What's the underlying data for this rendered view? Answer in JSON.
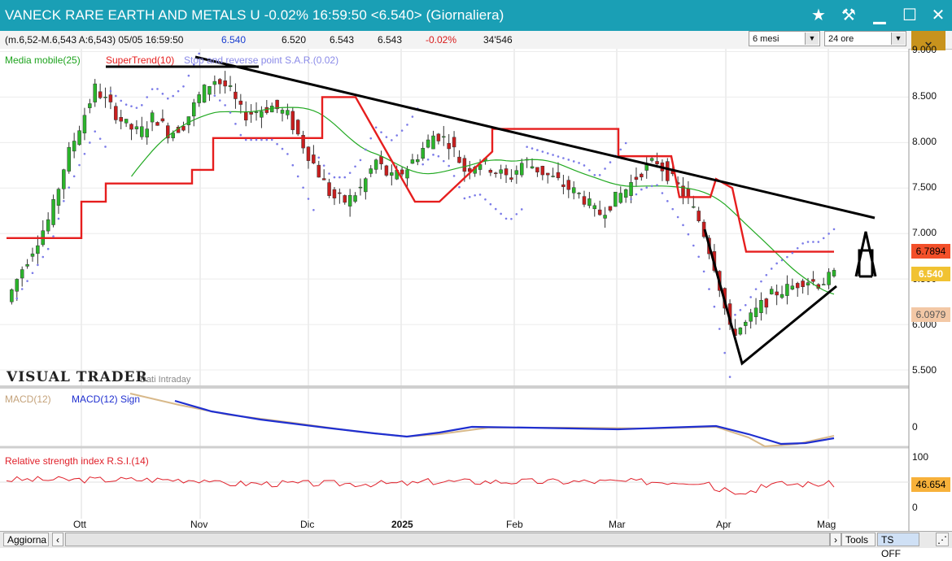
{
  "window": {
    "title": "VANECK RARE EARTH AND METALS U -0.02% 16:59:50 <6.540> (Giornaliera)",
    "icons": [
      "star-icon",
      "hammer-icon",
      "minimize-icon",
      "maximize-icon",
      "close-icon"
    ]
  },
  "infobar": {
    "summary": "(m.6,52-M.6,543 A:6,543) 05/05 16:59:50",
    "last": "6.540",
    "open": "6.520",
    "high": "6.543",
    "low": "6.543",
    "change": "-0.02%",
    "volume": "34'546",
    "period_select": "6 mesi",
    "session_select": "24 ore"
  },
  "indicators": {
    "ma": "Media mobile(25)",
    "supertrend": "SuperTrend(10)",
    "sar": "Stop and reverse point S.A.R.(0.02)",
    "macd": "MACD(12)",
    "macd_sign": "MACD(12) Sign",
    "rsi": "Relative strength index R.S.I.(14)"
  },
  "brand": {
    "logo": "VISUAL TRADER",
    "sub": "Dati Intraday"
  },
  "price_tags": {
    "supertrend": "6.7894",
    "last": "6.540",
    "sar": "6.0979",
    "rsi": "46.654"
  },
  "colors": {
    "titlebar": "#1a9fb5",
    "supertrend": "#e61e1e",
    "ma": "#22a922",
    "sar": "#7b7be8",
    "macd": "#1f2fd0",
    "signal": "#d2b48c",
    "rsi": "#e0202a"
  },
  "bottombar": {
    "update": "Aggiorna",
    "tools": "Tools",
    "ts": "TS OFF"
  },
  "chart_data": {
    "type": "candlestick",
    "yaxis": {
      "ticks": [
        "9.000",
        "8.500",
        "8.000",
        "7.500",
        "7.000",
        "6.500",
        "6.000",
        "5.500"
      ],
      "range": [
        5.5,
        9.0
      ]
    },
    "macd_axis": {
      "ticks": [
        "0"
      ]
    },
    "rsi_axis": {
      "ticks": [
        "100",
        "50",
        "0"
      ],
      "range": [
        0,
        100
      ]
    },
    "x_labels": [
      "Ott",
      "Nov",
      "Dic",
      "2025",
      "Feb",
      "Mar",
      "Apr",
      "Mag"
    ],
    "close_series": [
      6.25,
      6.6,
      6.9,
      7.2,
      7.8,
      8.2,
      8.6,
      8.4,
      8.2,
      8.1,
      8.3,
      8.1,
      8.2,
      8.5,
      8.7,
      8.6,
      8.3,
      8.35,
      8.4,
      8.3,
      8.0,
      7.7,
      7.4,
      7.35,
      7.5,
      7.8,
      7.6,
      7.7,
      7.9,
      8.1,
      8.0,
      7.7,
      7.8,
      7.7,
      7.6,
      7.8,
      7.7,
      7.6,
      7.5,
      7.4,
      7.2,
      7.35,
      7.5,
      7.7,
      7.8,
      7.6,
      7.4,
      7.1,
      6.6,
      5.9,
      6.0,
      6.2,
      6.35,
      6.4,
      6.5,
      6.45,
      6.54
    ]
  }
}
